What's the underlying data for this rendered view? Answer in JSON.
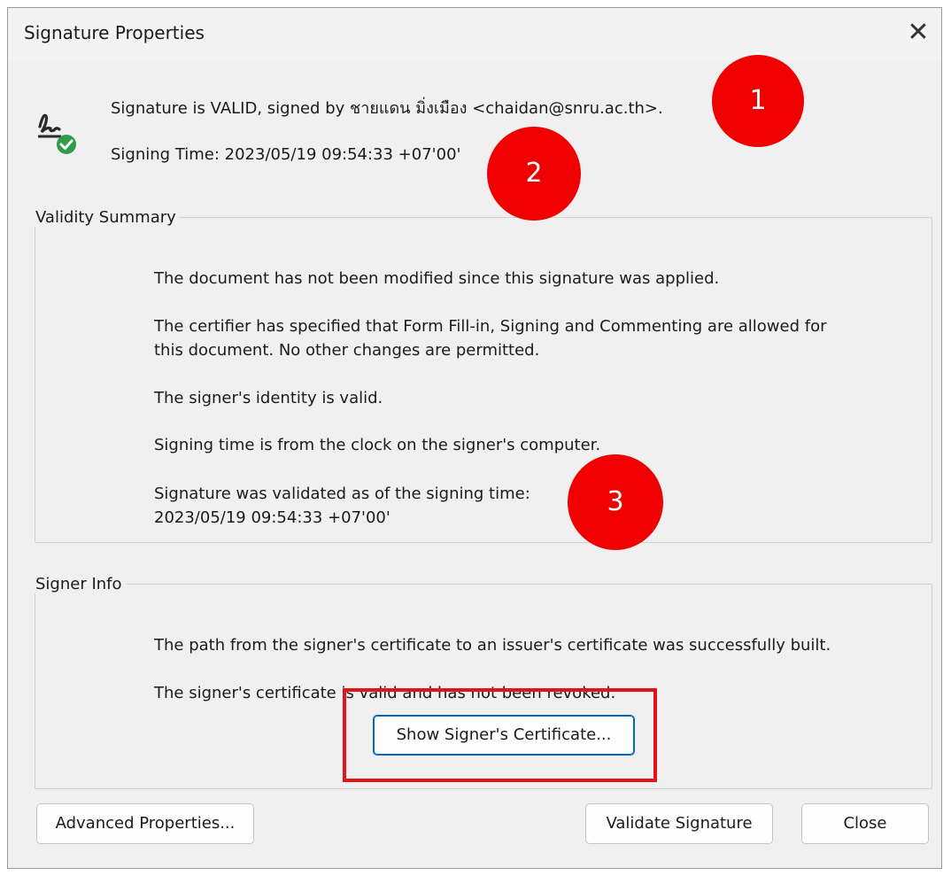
{
  "dialog": {
    "title": "Signature Properties",
    "close_glyph": "✕"
  },
  "header": {
    "icon": "signature-valid-icon",
    "status_text": "Signature is VALID, signed by ชายแดน มิ่งเมือง  <chaidan@snru.ac.th>.",
    "signing_time_text": "Signing Time:  2023/05/19 09:54:33 +07'00'"
  },
  "validity_summary": {
    "legend": "Validity Summary",
    "lines": [
      "The document has not been modified since this signature was applied.",
      "The certifier has specified that Form Fill-in, Signing and Commenting are allowed for",
      "this document. No other changes are permitted.",
      "The signer's identity is valid.",
      "Signing time is from the clock on the signer's computer.",
      "Signature was validated as of the signing time:",
      "2023/05/19 09:54:33 +07'00'"
    ]
  },
  "signer_info": {
    "legend": "Signer Info",
    "lines": [
      "The path from the signer's certificate to an issuer's certificate was successfully built.",
      "The signer's certificate is valid and has not been revoked."
    ],
    "show_certificate_label": "Show Signer's Certificate..."
  },
  "footer": {
    "advanced_label": "Advanced Properties...",
    "validate_label": "Validate Signature",
    "close_label": "Close"
  },
  "annotations": {
    "marker_1": "1",
    "marker_2": "2",
    "marker_3": "3",
    "marker_color": "#f00000",
    "highlight_color": "#e0141a"
  }
}
